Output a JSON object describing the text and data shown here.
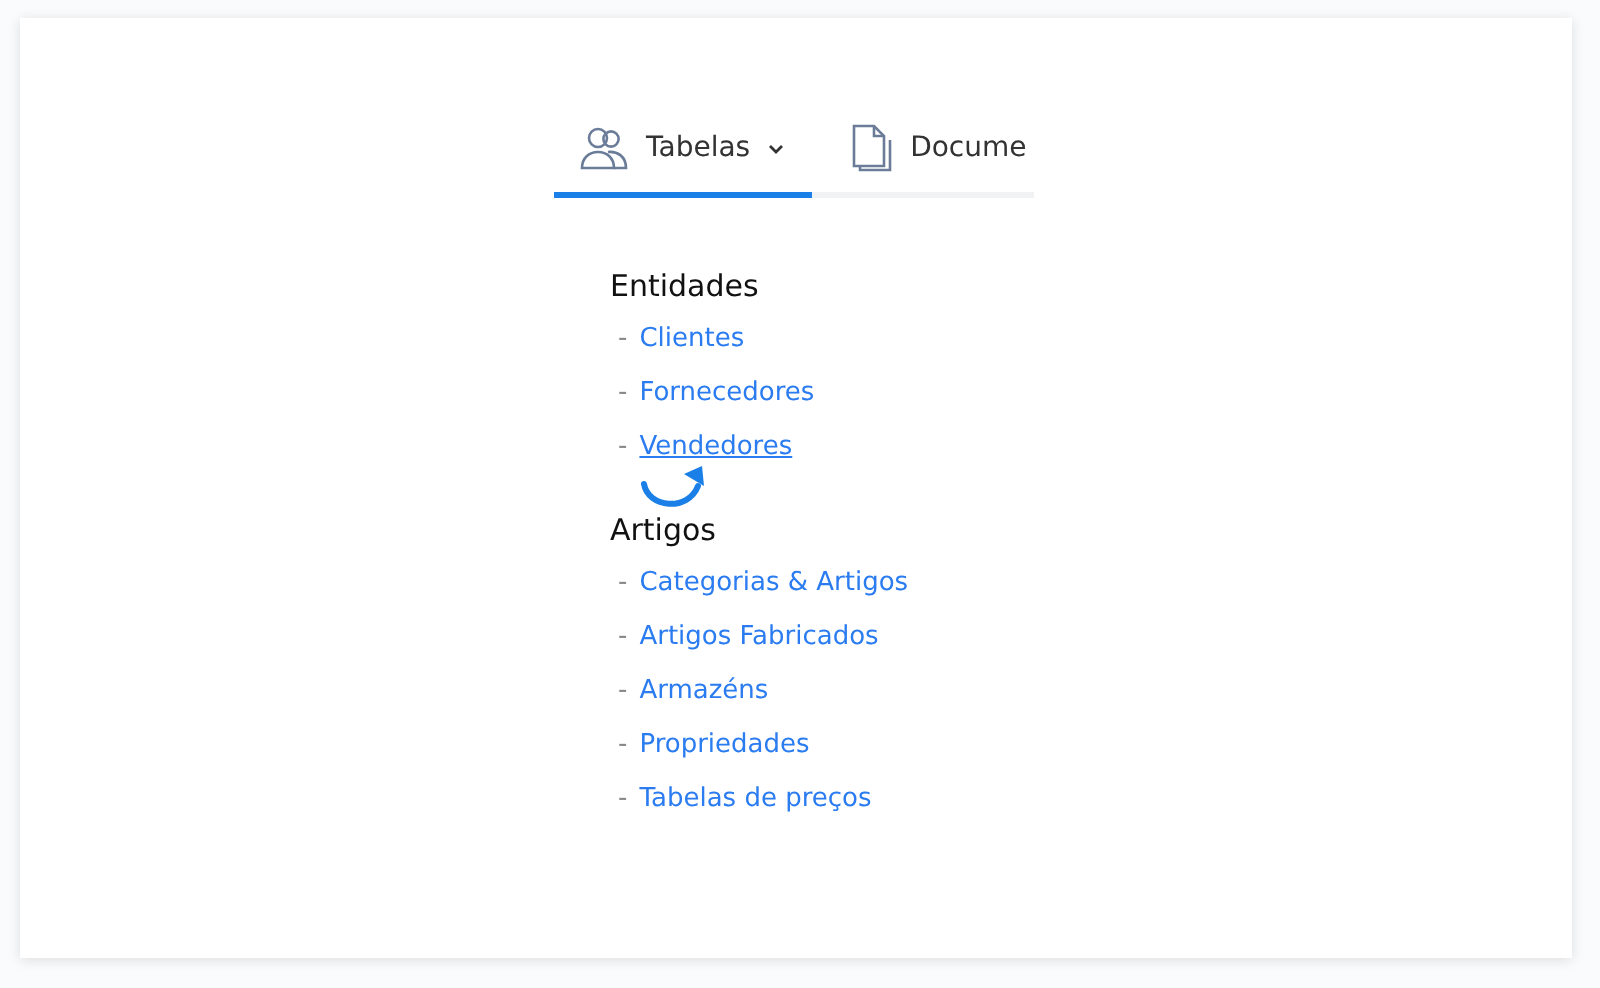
{
  "tabs": [
    {
      "label": "Tabelas",
      "kind": "people",
      "selected": true
    },
    {
      "label": "Docume",
      "kind": "document",
      "selected": false
    }
  ],
  "sections": [
    {
      "title": "Entidades",
      "items": [
        {
          "marker": "-",
          "label": "Clientes",
          "hovered": false
        },
        {
          "marker": "-",
          "label": "Fornecedores",
          "hovered": false
        },
        {
          "marker": "-",
          "label": "Vendedores",
          "hovered": true
        }
      ]
    },
    {
      "title": "Artigos",
      "items": [
        {
          "marker": "-",
          "label": "Categorias & Artigos",
          "hovered": false
        },
        {
          "marker": "-",
          "label": "Artigos Fabricados",
          "hovered": false
        },
        {
          "marker": "-",
          "label": "Armazéns",
          "hovered": false
        },
        {
          "marker": "-",
          "label": "Propriedades",
          "hovered": false
        },
        {
          "marker": "-",
          "label": "Tabelas de preços",
          "hovered": false
        }
      ]
    }
  ]
}
